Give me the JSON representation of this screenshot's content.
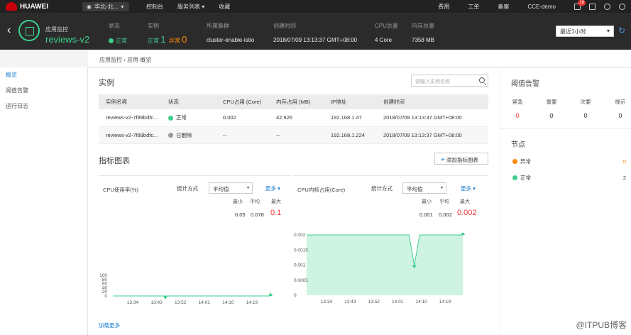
{
  "topbar": {
    "brand": "HUAWEI",
    "region": "华北-北...",
    "nav": [
      "控制台",
      "服务列表 ▾",
      "收藏"
    ],
    "right": [
      "费用",
      "工单",
      "备案",
      "CCE-demo"
    ],
    "mail_badge": "16"
  },
  "app": {
    "back": "‹",
    "subtitle": "应用监控",
    "name": "reviews-v2",
    "status_label": "状态",
    "status_value": "正常",
    "instances_label": "实例",
    "instances_ok_label": "正常",
    "instances_ok": "1",
    "instances_err_label": "异常",
    "instances_err": "0",
    "cluster_label": "所属集群",
    "cluster_value": "cluster-enable-istio",
    "created_label": "创建时间",
    "created_value": "2018/07/09 13:13:37 GMT+08:00",
    "cpu_label": "CPU总量",
    "cpu_value": "4 Core",
    "mem_label": "内存总量",
    "mem_value": "7358 MB",
    "time_range": "最近1小时"
  },
  "breadcrumb": "应用监控 › 应用 概览",
  "leftnav": [
    "概览",
    "阈值告警",
    "运行日志"
  ],
  "instances": {
    "title": "实例",
    "search_placeholder": "请输入实例名称",
    "columns": [
      "实例名称",
      "状态",
      "CPU占用 (Core)",
      "内存占用 (MB)",
      "IP地址",
      "创建时间"
    ],
    "rows": [
      {
        "name": "reviews-v2-7f89bdfc...",
        "status": "正常",
        "cpu": "0.002",
        "mem": "42.926",
        "ip": "192.168.1.47",
        "created": "2018/07/09 13:13:37 GMT+08:00"
      },
      {
        "name": "reviews-v2-7f89bdfc...",
        "status": "已删除",
        "cpu": "--",
        "mem": "--",
        "ip": "192.168.1.224",
        "created": "2018/07/09 13:13:37 GMT+08:00"
      }
    ]
  },
  "metrics": {
    "title": "指标图表",
    "add_button": "添加指标图表",
    "load_more": "加载更多"
  },
  "chart_data": [
    {
      "type": "area",
      "title": "CPU使用率(%)",
      "stat_method_label": "统计方式",
      "stat_method": "平均值",
      "more": "更多",
      "min_label": "最小",
      "avg_label": "平均",
      "max_label": "最大",
      "min": "0.05",
      "avg": "0.078",
      "max": "0.1",
      "x_ticks": [
        "13:34",
        "13:43",
        "13:52",
        "14:01",
        "14:10",
        "14:19"
      ],
      "y_ticks": [
        "100",
        "80",
        "60",
        "40",
        "20",
        "0"
      ],
      "ylim": [
        0,
        100
      ],
      "x": [
        0,
        1,
        2,
        3,
        4,
        5,
        6
      ],
      "values": [
        0.1,
        0.1,
        0.05,
        0.1,
        0.05,
        0.1,
        0.1
      ],
      "color": "#3ecf8e"
    },
    {
      "type": "area",
      "title": "CPU内核占用(Core)",
      "stat_method_label": "统计方式",
      "stat_method": "平均值",
      "more": "更多",
      "min_label": "最小",
      "avg_label": "平均",
      "max_label": "最大",
      "min": "0.001",
      "avg": "0.002",
      "max": "0.002",
      "x_ticks": [
        "13:34",
        "13:43",
        "13:52",
        "14:01",
        "14:10",
        "14:19"
      ],
      "y_ticks": [
        "0.002",
        "0.0015",
        "0.001",
        "0.0005",
        "0"
      ],
      "ylim": [
        0,
        0.002
      ],
      "x": [
        0,
        0.15,
        0.5,
        0.95,
        1,
        1.05,
        1.45
      ],
      "values": [
        0.002,
        0.002,
        0.002,
        0.002,
        0.001,
        0.002,
        0.002
      ],
      "color": "#3ecf8e"
    }
  ],
  "alarms": {
    "title": "阈值告警",
    "items": [
      {
        "label": "紧急",
        "count": "0"
      },
      {
        "label": "重要",
        "count": "0"
      },
      {
        "label": "次要",
        "count": "0"
      },
      {
        "label": "提示",
        "count": "0"
      }
    ]
  },
  "nodes": {
    "title": "节点",
    "items": [
      {
        "label": "异常",
        "count": "0",
        "color": "#ff8a00"
      },
      {
        "label": "正常",
        "count": "2",
        "color": "#3ecf8e"
      }
    ]
  },
  "watermark": "@ITPUB博客"
}
